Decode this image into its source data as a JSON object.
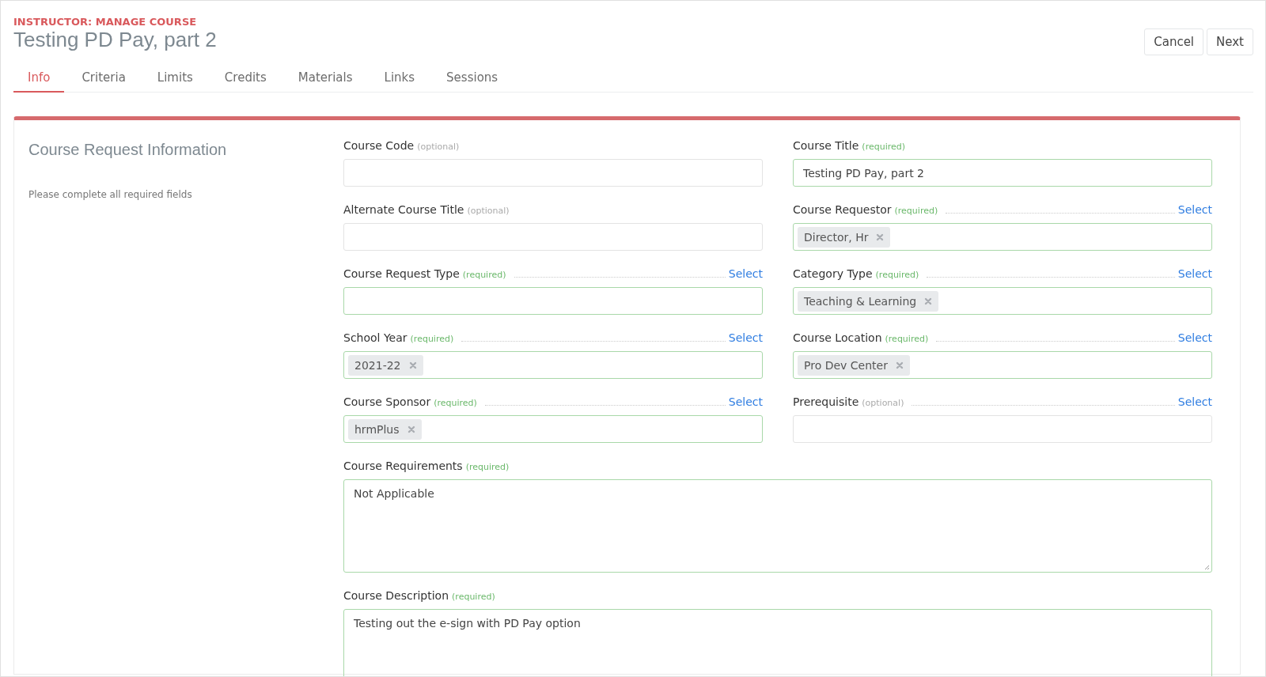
{
  "header": {
    "eyebrow": "INSTRUCTOR: MANAGE COURSE",
    "title": "Testing PD Pay, part 2"
  },
  "buttons": [
    "Cancel",
    "Next"
  ],
  "tabs": [
    {
      "label": "Info",
      "selected": true
    },
    {
      "label": "Criteria",
      "selected": false
    },
    {
      "label": "Limits",
      "selected": false
    },
    {
      "label": "Credits",
      "selected": false
    },
    {
      "label": "Materials",
      "selected": false
    },
    {
      "label": "Links",
      "selected": false
    },
    {
      "label": "Sessions",
      "selected": false
    }
  ],
  "section": {
    "title": "Course Request Information",
    "hint": "Please complete all required fields"
  },
  "fields": [
    {
      "kind": "text",
      "label": "Course Code",
      "note": "(optional)",
      "required": false
    },
    {
      "kind": "text",
      "label": "Course Title",
      "note": "(required)",
      "required": true,
      "value": "Testing PD Pay, part 2"
    },
    {
      "kind": "text",
      "label": "Alternate Course Title",
      "note": "(optional)",
      "required": false
    },
    {
      "kind": "tags",
      "label": "Course Requestor",
      "note": "(required)",
      "required": true,
      "select": "Select",
      "tags": [
        "Director, Hr"
      ]
    },
    {
      "kind": "tags",
      "label": "Course Request Type",
      "note": "(required)",
      "required": true,
      "select": "Select"
    },
    {
      "kind": "tags",
      "label": "Category Type",
      "note": "(required)",
      "required": true,
      "select": "Select",
      "tags": [
        "Teaching & Learning"
      ]
    },
    {
      "kind": "tags",
      "label": "School Year",
      "note": "(required)",
      "required": true,
      "select": "Select",
      "tags": [
        "2021-22"
      ]
    },
    {
      "kind": "tags",
      "label": "Course Location",
      "note": "(required)",
      "required": true,
      "select": "Select",
      "tags": [
        "Pro Dev Center"
      ]
    },
    {
      "kind": "tags",
      "label": "Course Sponsor",
      "note": "(required)",
      "required": true,
      "select": "Select",
      "tags": [
        "hrmPlus"
      ]
    },
    {
      "kind": "tags",
      "label": "Prerequisite",
      "note": "(optional)",
      "required": false,
      "select": "Select"
    },
    {
      "kind": "textarea",
      "label": "Course Requirements",
      "note": "(required)",
      "required": true,
      "value": "Not Applicable",
      "resizable": true
    },
    {
      "kind": "textarea",
      "label": "Course Description",
      "note": "(required)",
      "required": true,
      "value": "Testing out the e-sign with PD Pay option"
    }
  ]
}
